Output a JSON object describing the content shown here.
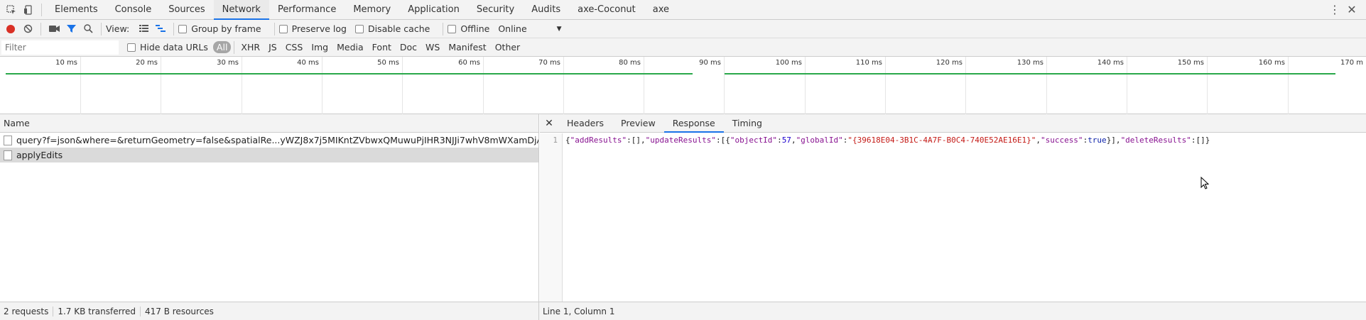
{
  "tabs": [
    "Elements",
    "Console",
    "Sources",
    "Network",
    "Performance",
    "Memory",
    "Application",
    "Security",
    "Audits",
    "axe-Coconut",
    "axe"
  ],
  "toolbar": {
    "view_label": "View:",
    "group_by_frame": "Group by frame",
    "preserve_log": "Preserve log",
    "disable_cache": "Disable cache",
    "offline": "Offline",
    "throttle": "Online"
  },
  "filter": {
    "placeholder": "Filter",
    "hide_data_urls": "Hide data URLs",
    "types": [
      "All",
      "XHR",
      "JS",
      "CSS",
      "Img",
      "Media",
      "Font",
      "Doc",
      "WS",
      "Manifest",
      "Other"
    ]
  },
  "overview": {
    "ticks": [
      "10 ms",
      "20 ms",
      "30 ms",
      "40 ms",
      "50 ms",
      "60 ms",
      "70 ms",
      "80 ms",
      "90 ms",
      "100 ms",
      "110 ms",
      "120 ms",
      "130 ms",
      "140 ms",
      "150 ms",
      "160 ms",
      "170 m"
    ]
  },
  "requests": {
    "header": "Name",
    "rows": [
      "query?f=json&where=&returnGeometry=false&spatialRe...yWZJ8x7j5MIKntZVbwxQMuwuPjIHR3NJJi7whV8mWXamDjA...",
      "applyEdits"
    ]
  },
  "detail": {
    "tabs": [
      "Headers",
      "Preview",
      "Response",
      "Timing"
    ],
    "line_number": "1",
    "response": {
      "p1": "{",
      "k1": "\"addResults\"",
      "p2": ":[],",
      "k2": "\"updateResults\"",
      "p3": ":[{",
      "k3": "\"objectId\"",
      "p4": ":",
      "n1": "57",
      "p5": ",",
      "k4": "\"globalId\"",
      "p6": ":",
      "s1": "\"{39618E04-3B1C-4A7F-B0C4-740E52AE16E1}\"",
      "p7": ",",
      "k5": "\"success\"",
      "p8": ":",
      "b1": "true",
      "p9": "}],",
      "k6": "\"deleteResults\"",
      "p10": ":[]}"
    }
  },
  "status": {
    "requests": "2 requests",
    "transferred": "1.7 KB transferred",
    "resources": "417 B resources",
    "position": "Line 1, Column 1"
  },
  "colors": {
    "accent": "#1a73e8",
    "record": "#d93025",
    "timeline": "#2aa84a"
  }
}
